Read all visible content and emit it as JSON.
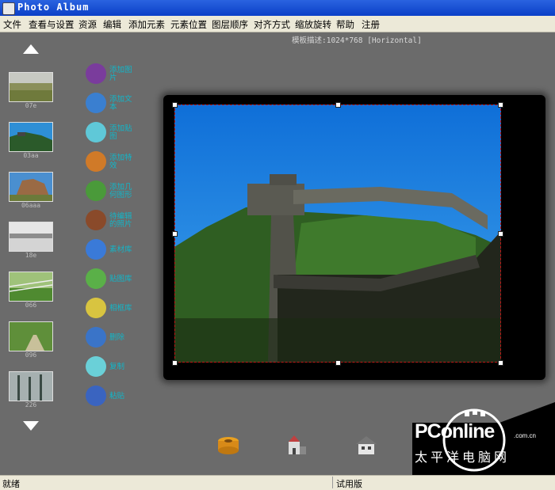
{
  "window": {
    "title": "Photo Album"
  },
  "menu": [
    "文件",
    "查看与设置",
    "资源",
    "编辑",
    "添加元素",
    "元素位置",
    "图层顺序",
    "对齐方式",
    "缩放旋转",
    "帮助",
    "注册"
  ],
  "template_desc": "模板描述:1024*768 [Horizontal]",
  "thumbnails": [
    {
      "caption": "07e",
      "icon": "grassland-photo"
    },
    {
      "caption": "03aa",
      "icon": "great-wall-photo"
    },
    {
      "caption": "06aaa",
      "icon": "rock-formation-photo"
    },
    {
      "caption": "18e",
      "icon": "snow-field-photo"
    },
    {
      "caption": "066",
      "icon": "fence-meadow-photo"
    },
    {
      "caption": "096",
      "icon": "forest-path-photo"
    },
    {
      "caption": "226",
      "icon": "misty-forest-photo"
    }
  ],
  "tools": [
    {
      "label": "添加图片",
      "icon": "purple-monster-icon"
    },
    {
      "label": "添加文本",
      "icon": "blue-bird-icon"
    },
    {
      "label": "添加贴图",
      "icon": "cyan-creature-icon"
    },
    {
      "label": "添加特效",
      "icon": "orange-creature-icon"
    },
    {
      "label": "添加几何图形",
      "icon": "green-creature-icon"
    },
    {
      "label": "待编辑的照片",
      "icon": "brown-bird-icon"
    },
    {
      "label": "素材库",
      "icon": "blue-dragon-icon"
    },
    {
      "label": "贴图库",
      "icon": "green-dragon-icon"
    },
    {
      "label": "相框库",
      "icon": "yellow-creature-icon"
    },
    {
      "label": "删除",
      "icon": "blue-fish-icon"
    },
    {
      "label": "复制",
      "icon": "cyan-seal-icon"
    },
    {
      "label": "粘贴",
      "icon": "blue-turtle-icon"
    }
  ],
  "bottom_tools": [
    {
      "icon": "film-reel-icon"
    },
    {
      "icon": "church-icon"
    },
    {
      "icon": "house-icon"
    }
  ],
  "status": {
    "left": "就绪",
    "right": "试用版"
  },
  "watermark": {
    "brand": "PConline",
    "domain": ".com.cn",
    "cn": "太平洋电脑网"
  },
  "colors": {
    "title_bar": "#0a3fc7",
    "menu_bg": "#ece9d8",
    "workspace": "#6b6b6b",
    "tool_label": "#12b6c8",
    "selection": "#c01818"
  }
}
